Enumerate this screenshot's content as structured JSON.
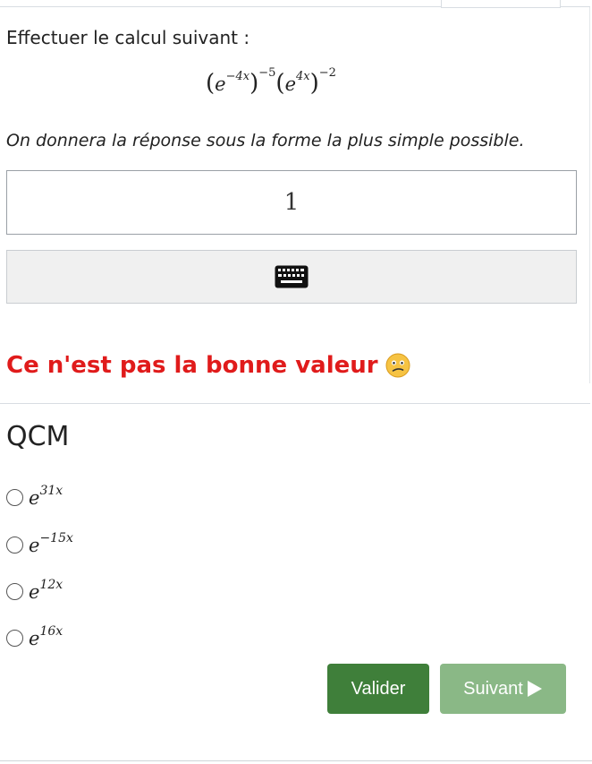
{
  "question": {
    "prompt": "Effectuer le calcul suivant :",
    "formula": {
      "base1": "e",
      "exp1": "−4x",
      "outer_exp1": "−5",
      "base2": "e",
      "exp2": "4x",
      "outer_exp2": "−2"
    },
    "hint": "On donnera la réponse sous la forme la plus simple possible."
  },
  "answer": {
    "value": "1"
  },
  "keyboard": {
    "icon": "keyboard-icon"
  },
  "feedback": {
    "text": "Ce n'est pas la bonne valeur",
    "icon": "confused-face-icon",
    "color": "#e01b1b"
  },
  "qcm": {
    "title": "QCM",
    "choices": [
      {
        "base": "e",
        "exponent": "31x"
      },
      {
        "base": "e",
        "exponent": "−15x"
      },
      {
        "base": "e",
        "exponent": "12x"
      },
      {
        "base": "e",
        "exponent": "16x"
      }
    ]
  },
  "buttons": {
    "validate": {
      "label": "Valider",
      "color": "#3f7f3a"
    },
    "next": {
      "label": "Suivant",
      "icon": "play-triangle-icon",
      "color": "#8ab886"
    }
  }
}
